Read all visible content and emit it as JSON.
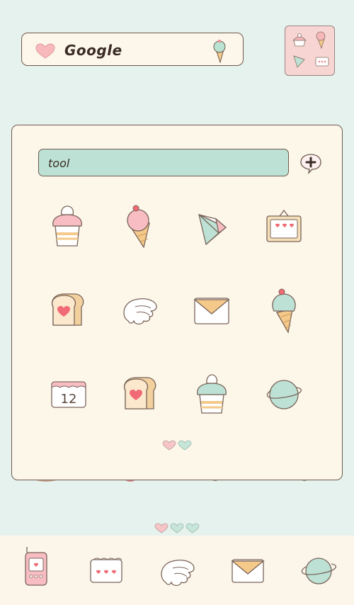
{
  "search_widget": {
    "label": "Google"
  },
  "folder": {
    "name": "tool",
    "apps": [
      {
        "icon": "cupcake-pink-icon"
      },
      {
        "icon": "ice-cream-pink-icon"
      },
      {
        "icon": "triangle-gem-icon"
      },
      {
        "icon": "tv-hearts-icon"
      },
      {
        "icon": "toast-heart-icon"
      },
      {
        "icon": "wing-icon"
      },
      {
        "icon": "envelope-icon"
      },
      {
        "icon": "ice-cream-mint-icon"
      },
      {
        "icon": "calendar-icon"
      },
      {
        "icon": "toast-heart-icon"
      },
      {
        "icon": "cupcake-mint-icon"
      },
      {
        "icon": "planet-icon"
      }
    ],
    "calendar_number": "12"
  },
  "dock": {
    "apps": [
      {
        "icon": "phone-icon"
      },
      {
        "icon": "calendar-hearts-icon"
      },
      {
        "icon": "wing-icon"
      },
      {
        "icon": "envelope-icon"
      },
      {
        "icon": "planet-icon"
      }
    ]
  },
  "colors": {
    "background": "#e6f2ee",
    "panel": "#fdf7ea",
    "mint": "#bde2d5",
    "pink": "#f5b7b9",
    "outline": "#6e5a4e"
  }
}
